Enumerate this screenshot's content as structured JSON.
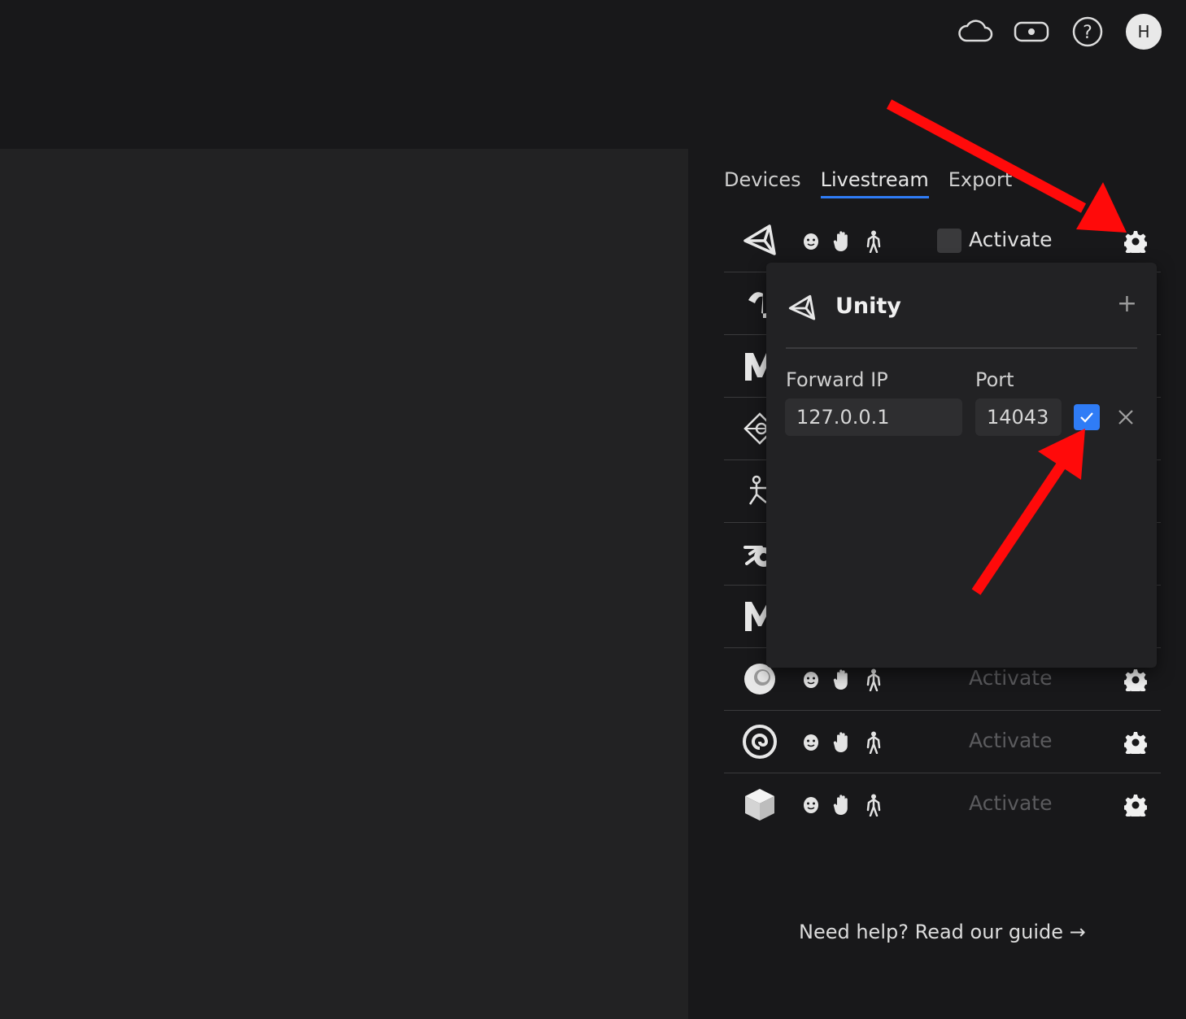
{
  "header": {
    "avatar_initial": "H",
    "icons": [
      "cloud-icon",
      "toggle-icon",
      "help-circle-icon",
      "avatar"
    ]
  },
  "tabs": [
    {
      "label": "Devices",
      "active": false
    },
    {
      "label": "Livestream",
      "active": true
    },
    {
      "label": "Export",
      "active": false
    }
  ],
  "integrations": [
    {
      "name": "unity",
      "logo": "unity-logo-icon",
      "activate_label": "Activate",
      "enabled": true,
      "checked": false
    },
    {
      "name": "unreal",
      "logo": "unreal-logo-icon"
    },
    {
      "name": "motionbuilder",
      "logo": "m-logo-icon"
    },
    {
      "name": "integration-4",
      "logo": "diamond-logo-icon"
    },
    {
      "name": "integration-5",
      "logo": "figure-logo-icon"
    },
    {
      "name": "blender",
      "logo": "blender-logo-icon"
    },
    {
      "name": "maya",
      "logo": "maya-logo-icon"
    },
    {
      "name": "cinema4d",
      "logo": "c4d-logo-icon",
      "activate_label": "Activate",
      "enabled": false
    },
    {
      "name": "houdini",
      "logo": "houdini-logo-icon",
      "activate_label": "Activate",
      "enabled": false
    },
    {
      "name": "generic",
      "logo": "cube-logo-icon",
      "activate_label": "Activate",
      "enabled": false
    }
  ],
  "popup": {
    "title": "Unity",
    "forward_ip_label": "Forward IP",
    "port_label": "Port",
    "forward_ip_value": "127.0.0.1",
    "port_value": "14043",
    "checked": true
  },
  "help_text": "Need help? Read our guide →",
  "colors": {
    "accent": "#2f7cf6",
    "annotation_arrow": "#ff0a0a"
  }
}
